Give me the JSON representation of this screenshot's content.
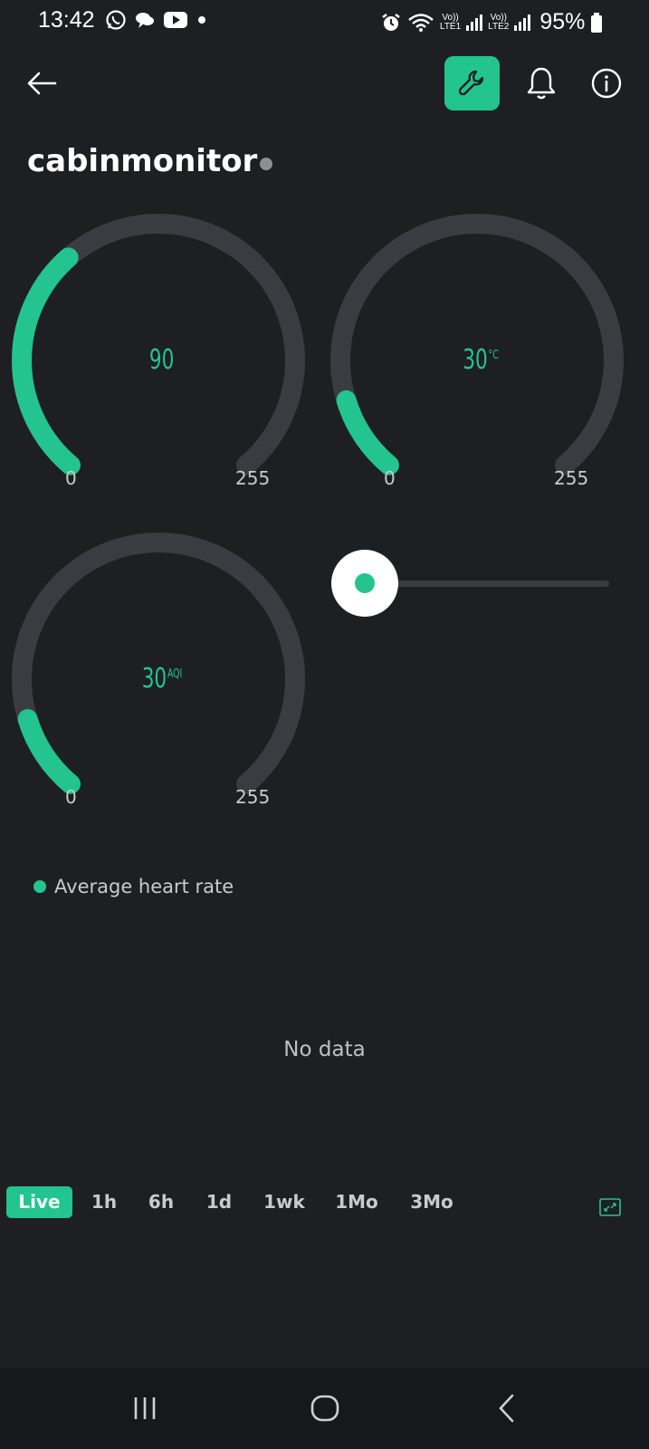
{
  "status_bar": {
    "time": "13:42",
    "battery": "95%",
    "sim1": {
      "top": "Vo))",
      "bottom": "LTE1"
    },
    "sim2": {
      "top": "Vo))",
      "bottom": "LTE2"
    },
    "notification_icons": [
      "whatsapp-icon",
      "chat-icon",
      "youtube-icon",
      "dot-icon"
    ],
    "system_icons": [
      "alarm-icon",
      "wifi-icon",
      "signal-icon",
      "battery-icon"
    ]
  },
  "header": {
    "back_icon": "arrow-left-icon",
    "settings_icon": "wrench-icon",
    "notifications_icon": "bell-icon",
    "info_icon": "info-icon"
  },
  "device": {
    "name": "cabinmonitor",
    "status": "offline"
  },
  "gauges": [
    {
      "value": "90",
      "unit": "",
      "min": "0",
      "max": "255",
      "fraction": 0.353
    },
    {
      "value": "30",
      "unit": "°C",
      "min": "0",
      "max": "255",
      "fraction": 0.118
    },
    {
      "value": "30",
      "unit": "AQI",
      "min": "0",
      "max": "255",
      "fraction": 0.118
    }
  ],
  "slider": {
    "value_fraction": 0.0
  },
  "chart": {
    "legend": "Average heart rate",
    "empty_text": "No data",
    "ranges": [
      "Live",
      "1h",
      "6h",
      "1d",
      "1wk",
      "1Mo",
      "3Mo"
    ],
    "active_range": "Live"
  },
  "colors": {
    "accent": "#23c48e",
    "background": "#1e1f23",
    "gauge_track": "#3b3c41"
  }
}
